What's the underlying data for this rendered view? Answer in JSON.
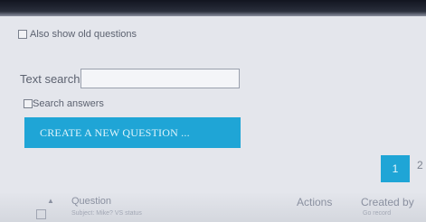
{
  "options": {
    "old_questions_label": "Also show old questions",
    "search_answers_label": "Search answers"
  },
  "search": {
    "label": "Text search",
    "value": "",
    "placeholder": ""
  },
  "actions": {
    "create_label": "CREATE A NEW QUESTION ..."
  },
  "pagination": {
    "current_page": "1",
    "next_page": "2"
  },
  "table": {
    "headers": {
      "question": "Question",
      "actions": "Actions",
      "created_by": "Created by"
    },
    "first_row_hint": "Subject: Mike? VS status",
    "first_row_created": "Go record"
  },
  "colors": {
    "accent": "#1fa5d6",
    "background": "#e4e6ec"
  }
}
